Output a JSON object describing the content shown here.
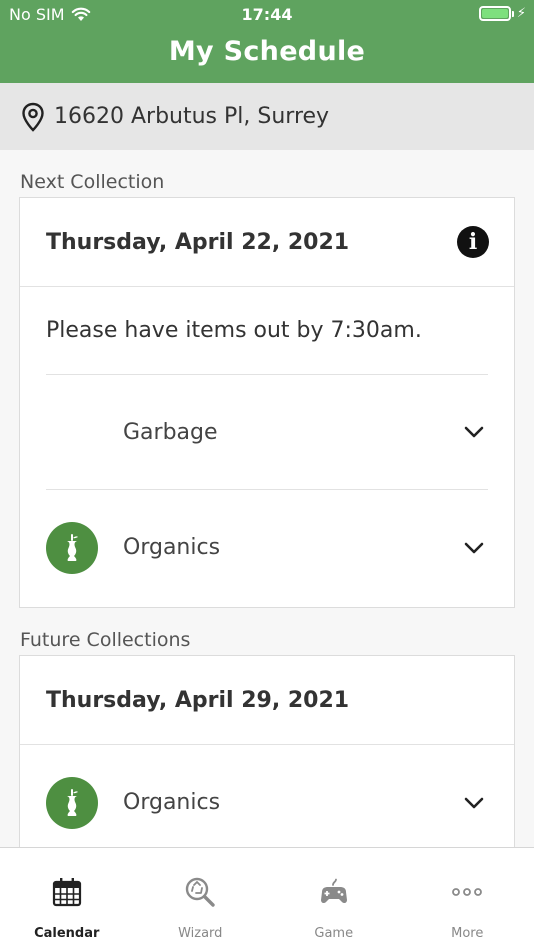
{
  "status_bar": {
    "carrier": "No SIM",
    "time": "17:44"
  },
  "header": {
    "title": "My Schedule"
  },
  "address": {
    "text": "16620 Arbutus Pl, Surrey"
  },
  "next_collection": {
    "section_label": "Next Collection",
    "date": "Thursday, April 22, 2021",
    "notice": "Please have items out by 7:30am.",
    "items": [
      {
        "label": "Garbage",
        "icon": "none"
      },
      {
        "label": "Organics",
        "icon": "organics-apple-core-icon"
      }
    ]
  },
  "future_collections": {
    "section_label": "Future Collections",
    "date": "Thursday, April 29, 2021",
    "items": [
      {
        "label": "Organics",
        "icon": "organics-apple-core-icon"
      }
    ]
  },
  "tabs": [
    {
      "label": "Calendar",
      "icon": "calendar-icon",
      "active": true
    },
    {
      "label": "Wizard",
      "icon": "recycle-search-icon",
      "active": false
    },
    {
      "label": "Game",
      "icon": "gamepad-icon",
      "active": false
    },
    {
      "label": "More",
      "icon": "more-dots-icon",
      "active": false
    }
  ],
  "colors": {
    "header": "#5fa35f",
    "organics_icon": "#4e8f41",
    "battery": "#7ee07e"
  }
}
